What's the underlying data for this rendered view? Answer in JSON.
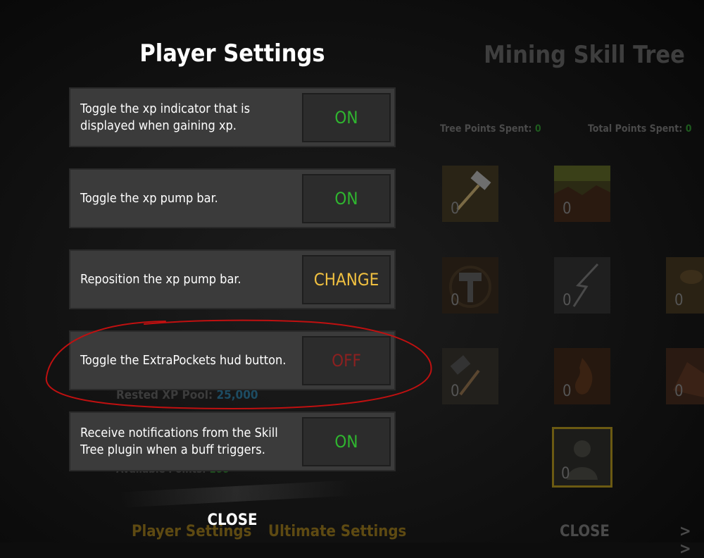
{
  "background_menu": {
    "title": "Mining Skill Tree",
    "tree_points_label": "Tree Points Spent:",
    "tree_points_value": "0",
    "total_points_label": "Total Points Spent:",
    "total_points_value": "0",
    "skills": [
      {
        "icon": "hammer-icon",
        "count": "0"
      },
      {
        "icon": "cave-icon",
        "count": "0"
      },
      {
        "icon": "mallet-icon",
        "count": "0"
      },
      {
        "icon": "lightning-icon",
        "count": "0"
      },
      {
        "icon": "ore-icon",
        "count": "0"
      },
      {
        "icon": "sledgehammer-icon",
        "count": "0"
      },
      {
        "icon": "flame-icon",
        "count": "0"
      },
      {
        "icon": "rock-icon",
        "count": "0"
      },
      {
        "icon": "miner-icon",
        "count": "0"
      }
    ],
    "rested_label": "Rested XP Pool:",
    "rested_value": "25,000",
    "available_label": "Available Points:",
    "available_value": "100",
    "nav_player_settings": "Player Settings",
    "nav_ultimate_settings": "Ultimate Settings",
    "close_label": "CLOSE",
    "next_arrows": "> >"
  },
  "player_settings": {
    "title": "Player Settings",
    "settings": [
      {
        "label": "Toggle the xp indicator that is displayed when gaining xp.",
        "button": "ON",
        "color": "#2fb62f"
      },
      {
        "label": "Toggle the xp pump bar.",
        "button": "ON",
        "color": "#2fb62f"
      },
      {
        "label": "Reposition the xp pump bar.",
        "button": "CHANGE",
        "color": "#f0c040"
      },
      {
        "label": "Toggle the ExtraPockets hud button.",
        "button": "OFF",
        "color": "#8c2020"
      },
      {
        "label": "Receive notifications from the Skill Tree plugin when a buff triggers.",
        "button": "ON",
        "color": "#2fb62f"
      }
    ],
    "close_label": "CLOSE"
  },
  "annotation_color": "#c01010"
}
